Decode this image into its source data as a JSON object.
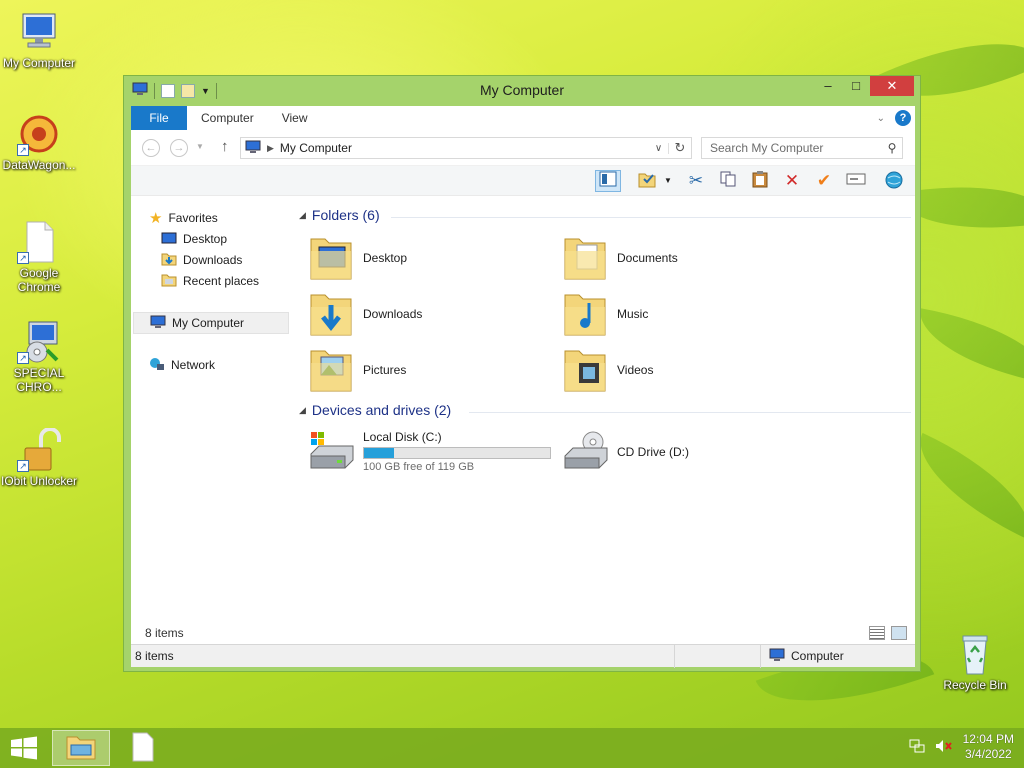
{
  "desktop": {
    "icons": [
      {
        "label": "My Computer",
        "icon": "computer-icon"
      },
      {
        "label": "DataWagon...",
        "icon": "datawagon-icon"
      },
      {
        "label": "Google Chrome",
        "icon": "file-icon"
      },
      {
        "label": "SPECIAL CHRO...",
        "icon": "installer-icon"
      },
      {
        "label": "IObit Unlocker",
        "icon": "padlock-icon"
      },
      {
        "label": "Recycle Bin",
        "icon": "recycle-bin-icon"
      }
    ]
  },
  "window": {
    "title": "My Computer",
    "controls": {
      "minimize": "–",
      "maximize": "□",
      "close": "✕"
    },
    "ribbon_tabs": [
      "File",
      "Computer",
      "View"
    ],
    "nav": {
      "back": "←",
      "forward": "→",
      "up": "↑",
      "address_path": "My Computer",
      "search_placeholder": "Search My Computer"
    },
    "sidebar": {
      "favorites": "Favorites",
      "favorites_items": [
        "Desktop",
        "Downloads",
        "Recent places"
      ],
      "this_pc": "My Computer",
      "network": "Network"
    },
    "folders_header": "Folders (6)",
    "folders": [
      {
        "label": "Desktop",
        "icon": "desktop-folder-icon"
      },
      {
        "label": "Documents",
        "icon": "documents-folder-icon"
      },
      {
        "label": "Downloads",
        "icon": "downloads-folder-icon"
      },
      {
        "label": "Music",
        "icon": "music-folder-icon"
      },
      {
        "label": "Pictures",
        "icon": "pictures-folder-icon"
      },
      {
        "label": "Videos",
        "icon": "videos-folder-icon"
      }
    ],
    "drives_header": "Devices and drives (2)",
    "drives": [
      {
        "label": "Local Disk (C:)",
        "free_text": "100 GB free of 119 GB",
        "used_fraction": 0.16,
        "icon": "hard-disk-icon"
      },
      {
        "label": "CD Drive (D:)",
        "icon": "cd-drive-icon"
      }
    ],
    "item_count": "8 items",
    "status": {
      "count": "8 items",
      "location": "Computer"
    }
  },
  "taskbar": {
    "time": "12:04 PM",
    "date": "3/4/2022"
  },
  "colors": {
    "accent": "#1979ca",
    "frame": "#a5d36b",
    "close": "#d13f3f",
    "progress": "#26a0da",
    "header_text": "#1e3287"
  }
}
